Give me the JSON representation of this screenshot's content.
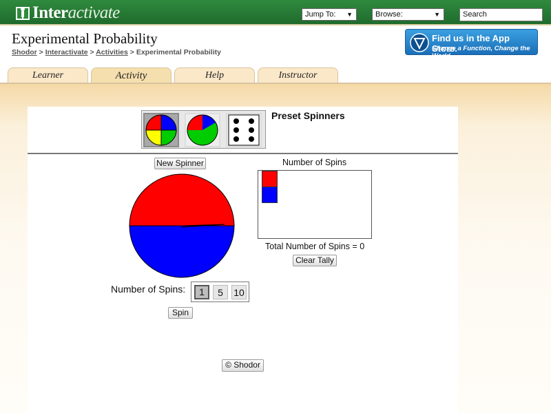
{
  "topbar": {
    "logo_text_bold": "Inter",
    "logo_text_italic": "activate",
    "jump_to": "Jump To:",
    "browse": "Browse:",
    "search": "Search"
  },
  "header": {
    "title": "Experimental Probability",
    "breadcrumb": [
      "Shodor",
      "Interactivate",
      "Activities",
      "Experimental Probability"
    ],
    "appstore_line1": "Find us in the App Store.",
    "appstore_line2": "Change a Function, Change the World"
  },
  "tabs": [
    {
      "label": "Learner",
      "active": false
    },
    {
      "label": "Activity",
      "active": true
    },
    {
      "label": "Help",
      "active": false
    },
    {
      "label": "Instructor",
      "active": false
    }
  ],
  "applet": {
    "preset_label": "Preset Spinners",
    "new_spinner": "New Spinner",
    "number_of_spins_label": "Number of Spins:",
    "spin_counts": [
      "1",
      "5",
      "10"
    ],
    "selected_count": "1",
    "spin_button": "Spin",
    "tally_title": "Number of Spins",
    "total_spins": "Total Number of Spins = 0",
    "clear_tally": "Clear Tally",
    "copyright": "© Shodor",
    "spinner_colors": [
      "#ff0000",
      "#0000ff"
    ],
    "tally_colors": [
      "#ff0000",
      "#0000ff"
    ]
  }
}
